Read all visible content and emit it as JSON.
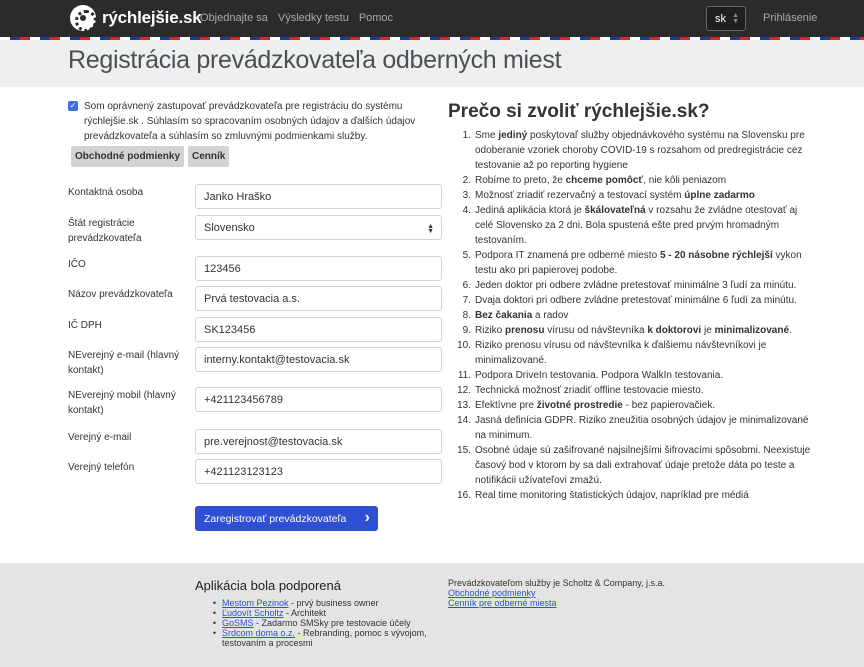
{
  "nav": {
    "brand": "rýchlejšie.sk",
    "links": [
      "Objednajte sa",
      "Výsledky testu",
      "Pomoc"
    ],
    "lang": "sk",
    "login": "Prihlásenie"
  },
  "page_title": "Registrácia prevádzkovateľa odberných miest",
  "consent": {
    "checked": true,
    "text": "Som oprávnený zastupovať prevádzkovateľa pre registráciu do systému rýchlejšie.sk . Súhlasím so spracovaním osobných údajov a ďalších údajov prevádzkovateľa a súhlasím so zmluvnými podmienkami služby.",
    "buttons": [
      "Obchodné podmienky",
      "Cenník"
    ]
  },
  "form": [
    {
      "label": "Kontaktná osoba",
      "value": "Janko Hraško"
    },
    {
      "label": "Štát registrácie prevádzkovateľa",
      "value": "Slovensko",
      "select": true
    },
    {
      "label": "IČO",
      "value": "123456"
    },
    {
      "label": "Názov prevádzkovateľa",
      "value": "Prvá testovacia a.s."
    },
    {
      "label": "IČ DPH",
      "value": "SK123456"
    },
    {
      "label": "NEverejný e-mail (hlavný kontakt)",
      "value": "interny.kontakt@testovacia.sk"
    },
    {
      "label": "NEverejný mobil (hlavný kontakt)",
      "value": "+421123456789"
    },
    {
      "label": "Verejný e-mail",
      "value": "pre.verejnost@testovacia.sk"
    },
    {
      "label": "Verejný telefón",
      "value": "+421123123123"
    }
  ],
  "submit_label": "Zaregistrovať prevádzkovateľa",
  "why": {
    "title": "Prečo si zvoliť rýchlejšie.sk?",
    "items": [
      "Sme <b>jediný</b> poskytovaľ služby objednávkového systému na Slovensku pre odoberanie vzoriek choroby COVID-19 s rozsahom od predregistrácie cez testovanie až po reporting hygiene",
      "Robíme to preto, že <b>chceme pomôcť</b>, nie kôli peniazom",
      "Možnosť zriadiť rezervačný a testovací systém <b>úplne zadarmo</b>",
      "Jediná aplikácia ktorá je <b>škálovateľná</b> v rozsahu že zvládne otestovať aj celé Slovensko za 2 dni. Bola spustená ešte pred prvým hromadným testovaním.",
      "Podpora IT znamená pre odberné miesto <b>5 - 20 násobne rýchlejší</b> vykon testu ako pri papierovej podobe.",
      "Jeden doktor pri odbere zvládne pretestovať minimálne 3 ľudí za minútu.",
      "Dvaja doktori pri odbere zvládne pretestovať minimálne 6 ľudí za minútu.",
      "<b>Bez čakania</b> a radov",
      "Riziko <b>prenosu</b> vírusu od návštevníka <b>k doktorovi</b> je <b>minimalizované</b>.",
      "Riziko prenosu vírusu od návštevníka k ďalšiemu návštevníkovi je minimalizované.",
      "Podpora DriveIn testovania. Podpora WalkIn testovania.",
      "Technická možnosť zriadiť offline testovacie miesto.",
      "Efektívne pre <b>životné prostredie</b> - bez papierovačiek.",
      "Jasná definícia GDPR. Riziko zneužitia osobných údajov je minimalizované na minimum.",
      "Osobné údaje sú zašifrované najsilnejšími šifrovacími spôsobmi. Neexistuje časový bod v ktorom by sa dali extrahovať údaje pretože dáta po teste a notifikácii užívateľovi zmažú.",
      "Real time monitoring štatistických údajov, napríklad pre médiá"
    ]
  },
  "footer": {
    "heading": "Aplikácia bola podporená",
    "supporters": [
      {
        "link": "Mestom Pezinok",
        "rest": " - prvý business owner"
      },
      {
        "link": "Ľudovít Scholtz",
        "rest": " - Architekt"
      },
      {
        "link": "GoSMS",
        "rest": " - Zadarmo SMSky pre testovacie účely"
      },
      {
        "link": "Srdcom doma o.z.",
        "rest": " - Rebranding, pomoc s vývojom, testovaním a procesmi"
      }
    ],
    "operator": "Prevádzkovateľom služby je Scholtz & Company, j.s.a.",
    "links": [
      "Obchodné podmienky",
      "Cenník pre odberné miesta"
    ]
  }
}
